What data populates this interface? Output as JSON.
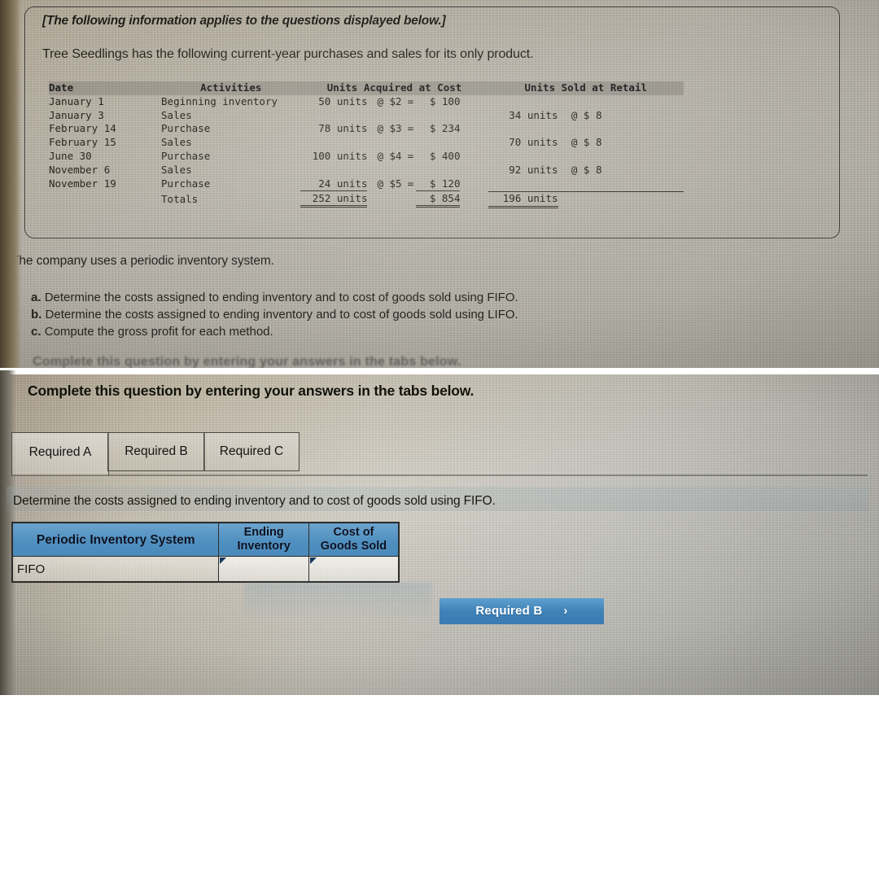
{
  "info_card": {
    "intro": "[The following information applies to the questions displayed below.]",
    "subtitle": "Tree Seedlings has the following current-year purchases and sales for its only product.",
    "table": {
      "headers": {
        "date": "Date",
        "activities": "Activities",
        "acquired": "Units Acquired at Cost",
        "sold": "Units Sold at Retail"
      },
      "rows": [
        {
          "date": "January 1",
          "activity": "Beginning inventory",
          "acq_units": "50 units",
          "acq_at": "@ $2",
          "acq_eq": "=",
          "acq_amt": "$ 100",
          "sold_units": "",
          "sold_at": ""
        },
        {
          "date": "January 3",
          "activity": "Sales",
          "acq_units": "",
          "acq_at": "",
          "acq_eq": "",
          "acq_amt": "",
          "sold_units": "34 units",
          "sold_at": "@ $ 8"
        },
        {
          "date": "February 14",
          "activity": "Purchase",
          "acq_units": "78 units",
          "acq_at": "@ $3",
          "acq_eq": "=",
          "acq_amt": "$ 234",
          "sold_units": "",
          "sold_at": ""
        },
        {
          "date": "February 15",
          "activity": "Sales",
          "acq_units": "",
          "acq_at": "",
          "acq_eq": "",
          "acq_amt": "",
          "sold_units": "70 units",
          "sold_at": "@ $ 8"
        },
        {
          "date": "June 30",
          "activity": "Purchase",
          "acq_units": "100 units",
          "acq_at": "@ $4",
          "acq_eq": "=",
          "acq_amt": "$ 400",
          "sold_units": "",
          "sold_at": ""
        },
        {
          "date": "November 6",
          "activity": "Sales",
          "acq_units": "",
          "acq_at": "",
          "acq_eq": "",
          "acq_amt": "",
          "sold_units": "92 units",
          "sold_at": "@ $ 8"
        },
        {
          "date": "November 19",
          "activity": "Purchase",
          "acq_units": "24 units",
          "acq_at": "@ $5",
          "acq_eq": "=",
          "acq_amt": "$ 120",
          "sold_units": "",
          "sold_at": ""
        }
      ],
      "totals": {
        "label": "Totals",
        "acq_units": "252 units",
        "acq_amt": "$ 854",
        "sold_units": "196 units"
      }
    }
  },
  "question": {
    "periodic_note": "The company uses a periodic inventory system.",
    "items": [
      {
        "marker": "a.",
        "text": "Determine the costs assigned to ending inventory and to cost of goods sold using FIFO."
      },
      {
        "marker": "b.",
        "text": "Determine the costs assigned to ending inventory and to cost of goods sold using LIFO."
      },
      {
        "marker": "c.",
        "text": "Compute the gross profit for each method."
      }
    ],
    "cutoff_line": "Complete this question by entering your answers in the tabs below."
  },
  "answer_panel": {
    "complete_header": "Complete this question by entering your answers in the tabs below.",
    "tabs": [
      {
        "label": "Required A",
        "active": true
      },
      {
        "label": "Required B",
        "active": false
      },
      {
        "label": "Required C",
        "active": false
      }
    ],
    "instruction": "Determine the costs assigned to ending inventory and to cost of goods sold using FIFO.",
    "grid": {
      "headers": {
        "system": "Periodic Inventory System",
        "ending_inventory": "Ending Inventory",
        "ending_inventory_l1": "Ending",
        "ending_inventory_l2": "Inventory",
        "cost_of_goods_sold": "Cost of Goods Sold",
        "cost_of_goods_sold_l1": "Cost of",
        "cost_of_goods_sold_l2": "Goods Sold"
      },
      "rows": [
        {
          "label": "FIFO",
          "ending_inventory": "",
          "cost_of_goods_sold": ""
        }
      ]
    },
    "next_button": {
      "label": "Required B",
      "chevron": "›"
    }
  },
  "colors": {
    "header_blue": "#4e8fc0",
    "button_blue": "#3f82b8",
    "marker_navy": "#17365d"
  }
}
